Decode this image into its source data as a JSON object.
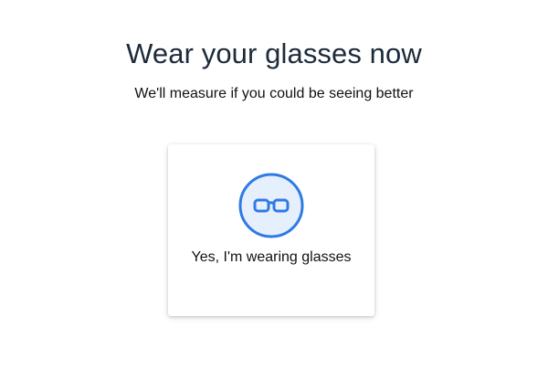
{
  "header": {
    "title": "Wear your glasses now",
    "subtitle": "We'll measure if you could be seeing better"
  },
  "option_card": {
    "icon": "glasses-icon",
    "label": "Yes, I'm wearing glasses",
    "colors": {
      "accent": "#2f7ae5",
      "icon_fill": "#e6f0fd"
    }
  }
}
